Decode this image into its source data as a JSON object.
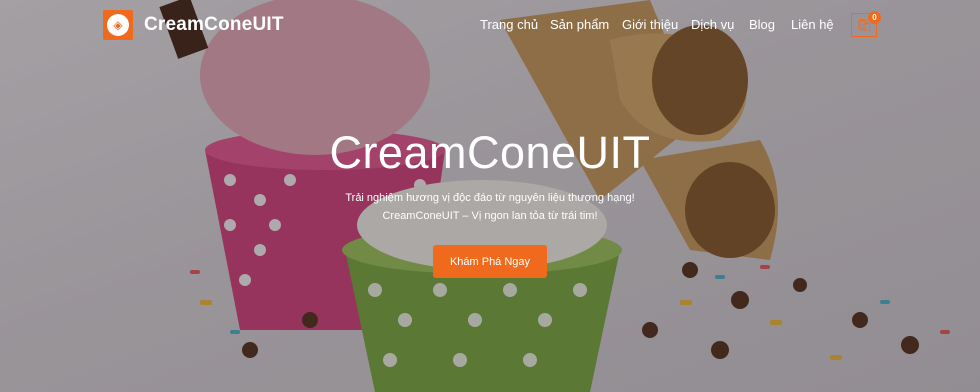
{
  "brand": {
    "name": "CreamConeUIT",
    "logo_icon": "ice-cream-cone-icon"
  },
  "nav": {
    "items": [
      {
        "label": "Trang chủ"
      },
      {
        "label": "Sản phẩm"
      },
      {
        "label": "Giới thiệu"
      },
      {
        "label": "Dịch vụ"
      },
      {
        "label": "Blog"
      },
      {
        "label": "Liên hệ"
      }
    ]
  },
  "cart": {
    "icon": "shopping-bag-icon",
    "count": "0"
  },
  "hero": {
    "title": "CreamConeUIT",
    "subtitle_line1": "Trải nghiệm hương vị độc đáo từ nguyên liệu thượng hạng!",
    "subtitle_line2": "CreamConeUIT – Vị ngon lan tỏa từ trái tim!",
    "cta_label": "Khám Phá Ngay"
  },
  "colors": {
    "accent": "#f06a1e",
    "text": "#ffffff"
  }
}
